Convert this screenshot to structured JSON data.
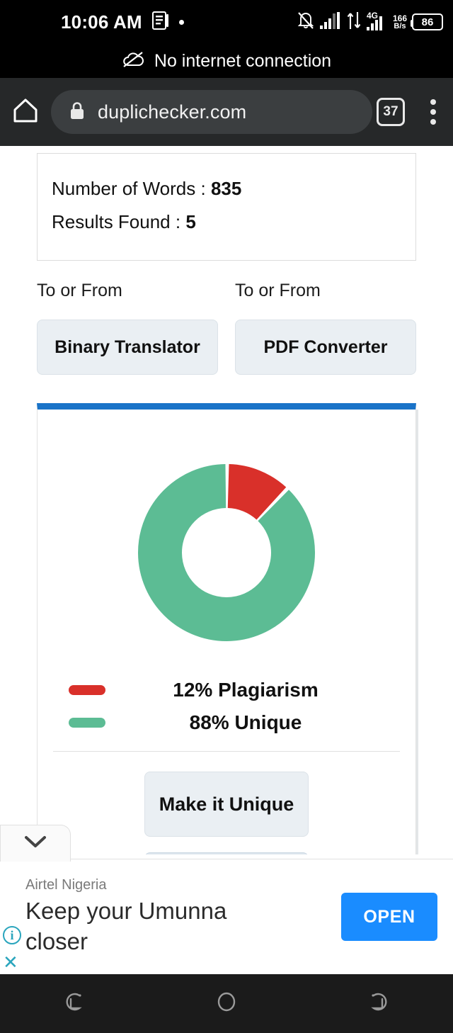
{
  "status_bar": {
    "time": "10:06 AM",
    "notification_icon": "document-icon",
    "dot_icon": "dot-icon",
    "silent_icon": "bell-muted-icon",
    "signal_icon": "signal-bars-icon",
    "data_transfer_icon": "data-arrows-icon",
    "network_type": "4G",
    "network_signal_icon": "signal-bars-icon",
    "net_speed_value": "166",
    "net_speed_unit": "B/s",
    "battery_level": "86"
  },
  "offline_banner": {
    "icon": "cloud-off-icon",
    "message": "No internet connection"
  },
  "browser": {
    "home_icon": "home-icon",
    "lock_icon": "lock-icon",
    "url": "duplichecker.com",
    "tab_count": "37",
    "menu_icon": "kebab-menu-icon"
  },
  "results": {
    "words_label": "Number of Words : ",
    "words_value": "835",
    "found_label": "Results Found : ",
    "found_value": "5"
  },
  "tools": [
    {
      "label": "To or From",
      "button": "Binary Translator"
    },
    {
      "label": "To or From",
      "button": "PDF Converter"
    }
  ],
  "report": {
    "accent_color": "#1a73c8",
    "make_unique_button": "Make it Unique",
    "legend": [
      {
        "color": "#d9302a",
        "text": "12% Plagiarism"
      },
      {
        "color": "#5cbc94",
        "text": "88% Unique"
      }
    ]
  },
  "chart_data": {
    "type": "pie",
    "title": "",
    "variant": "donut",
    "start_angle": 0,
    "inner_radius_ratio": 0.58,
    "categories": [
      "Plagiarism",
      "Unique"
    ],
    "values": [
      12,
      88
    ],
    "labels": [
      "12% Plagiarism",
      "88% Unique"
    ],
    "colors": [
      "#d9302a",
      "#5cbc94"
    ],
    "legend_position": "bottom",
    "units": "percent"
  },
  "ad": {
    "collapse_icon": "chevron-down-icon",
    "advertiser": "Airtel Nigeria",
    "headline": "Keep your Umunna closer",
    "cta_label": "OPEN",
    "info_icon": "info-icon",
    "close_icon": "close-icon",
    "cta_color": "#1a8cff"
  },
  "nav_bar": {
    "back_icon": "back-icon",
    "home_icon": "home-circle-icon",
    "recents_icon": "recents-icon"
  }
}
